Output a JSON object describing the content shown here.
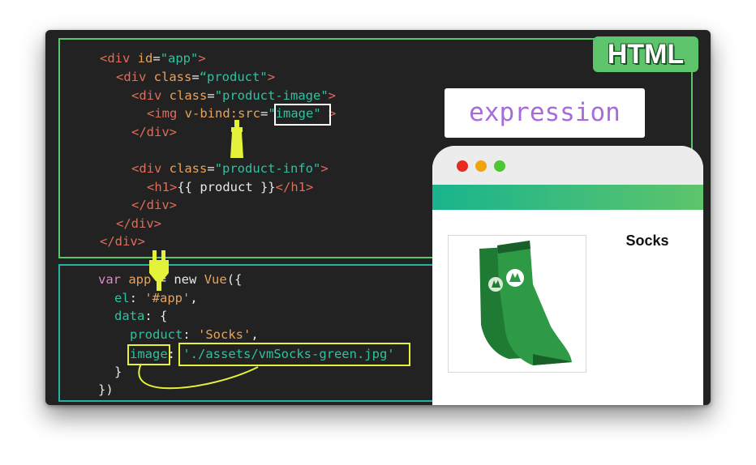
{
  "html_badge": "HTML",
  "expression_label": "expression",
  "html_code": {
    "line1": {
      "open": "<div ",
      "attr": "id",
      "eq": "=",
      "val": "\"app\"",
      "close": ">"
    },
    "line2": {
      "open": "<div ",
      "attr": "class",
      "eq": "=",
      "val": "“product\"",
      "close": ">"
    },
    "line3": {
      "open": "<div ",
      "attr": "class",
      "eq": "=",
      "val": "\"product-image\"",
      "close": ">"
    },
    "line4": {
      "open": "<img ",
      "attr": "v-bind:src",
      "eq": "=",
      "q1": "\"",
      "val": "image",
      "q2": "\"",
      "close": " >"
    },
    "line5": "</div>",
    "line6": {
      "open": "<div ",
      "attr": "class",
      "eq": "=",
      "val": "\"product-info\"",
      "close": ">"
    },
    "line7": {
      "open": "<h1>",
      "text": "{{ product }}",
      "close": "</h1>"
    },
    "line8": "</div>",
    "line9": "</div>",
    "line10": "</div>"
  },
  "js_code": {
    "line1": {
      "kw": "var",
      "name": "app",
      "eq": " = ",
      "new": "new",
      "cls": "Vue",
      "open": "({"
    },
    "line2": {
      "key": "el",
      "colon": ": ",
      "val": "'#app'",
      "comma": ","
    },
    "line3": {
      "key": "data",
      "colon": ": ",
      "open": "{"
    },
    "line4": {
      "key": "product",
      "colon": ": ",
      "val": "'Socks'",
      "comma": ","
    },
    "line5": {
      "key": "image",
      "colon": ": ",
      "val": "'./assets/vmSocks-green.jpg'"
    },
    "line6": "}",
    "line7": "})"
  },
  "browser": {
    "product_title": "Socks"
  },
  "colors": {
    "html_accent": "#5ec46b",
    "js_accent": "#25b2a3",
    "highlight_yellow": "#e5f23a",
    "expression_purple": "#a86bdb"
  }
}
